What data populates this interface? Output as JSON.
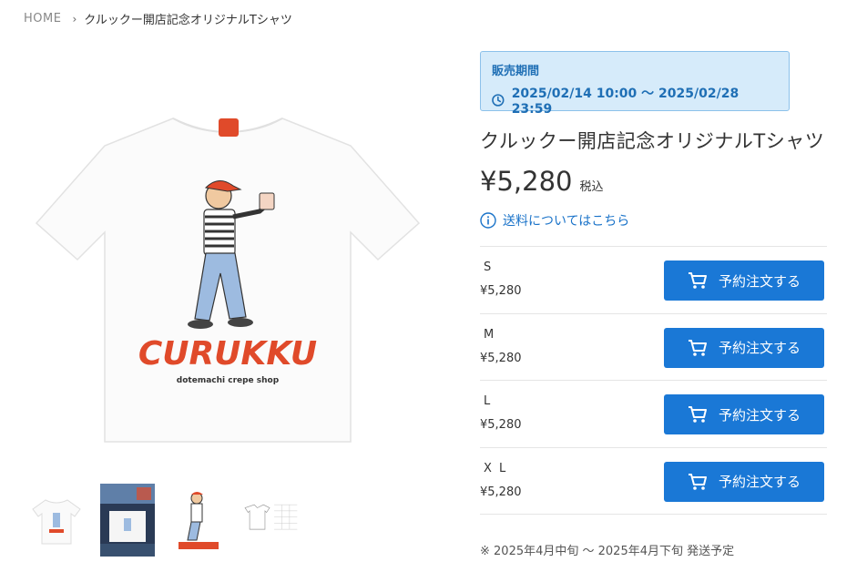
{
  "breadcrumb": {
    "home": "HOME",
    "separator": "›",
    "current": "クルックー開店記念オリジナルTシャツ"
  },
  "sale_period": {
    "title": "販売期間",
    "icon": "clock-icon",
    "range": "2025/02/14 10:00 〜 2025/02/28 23:59"
  },
  "product": {
    "title": "クルックー開店記念オリジナルTシャツ",
    "price": "¥5,280",
    "tax_label": "税込",
    "shipping_link": "送料についてはこちら",
    "image_brand": "CURUKKU",
    "image_tagline": "dotemachi crepe shop"
  },
  "variants": [
    {
      "name": "S",
      "price": "¥5,280",
      "button": "予約注文する"
    },
    {
      "name": "M",
      "price": "¥5,280",
      "button": "予約注文する"
    },
    {
      "name": "L",
      "price": "¥5,280",
      "button": "予約注文する"
    },
    {
      "name": "X L",
      "price": "¥5,280",
      "button": "予約注文する"
    }
  ],
  "shipping_note": "※ 2025年4月中旬 〜 2025年4月下旬 発送予定",
  "colors": {
    "accent": "#1a78d6",
    "period_bg": "#d6ebfa",
    "period_text": "#1f6fb5",
    "logo_red": "#e04a2a"
  }
}
